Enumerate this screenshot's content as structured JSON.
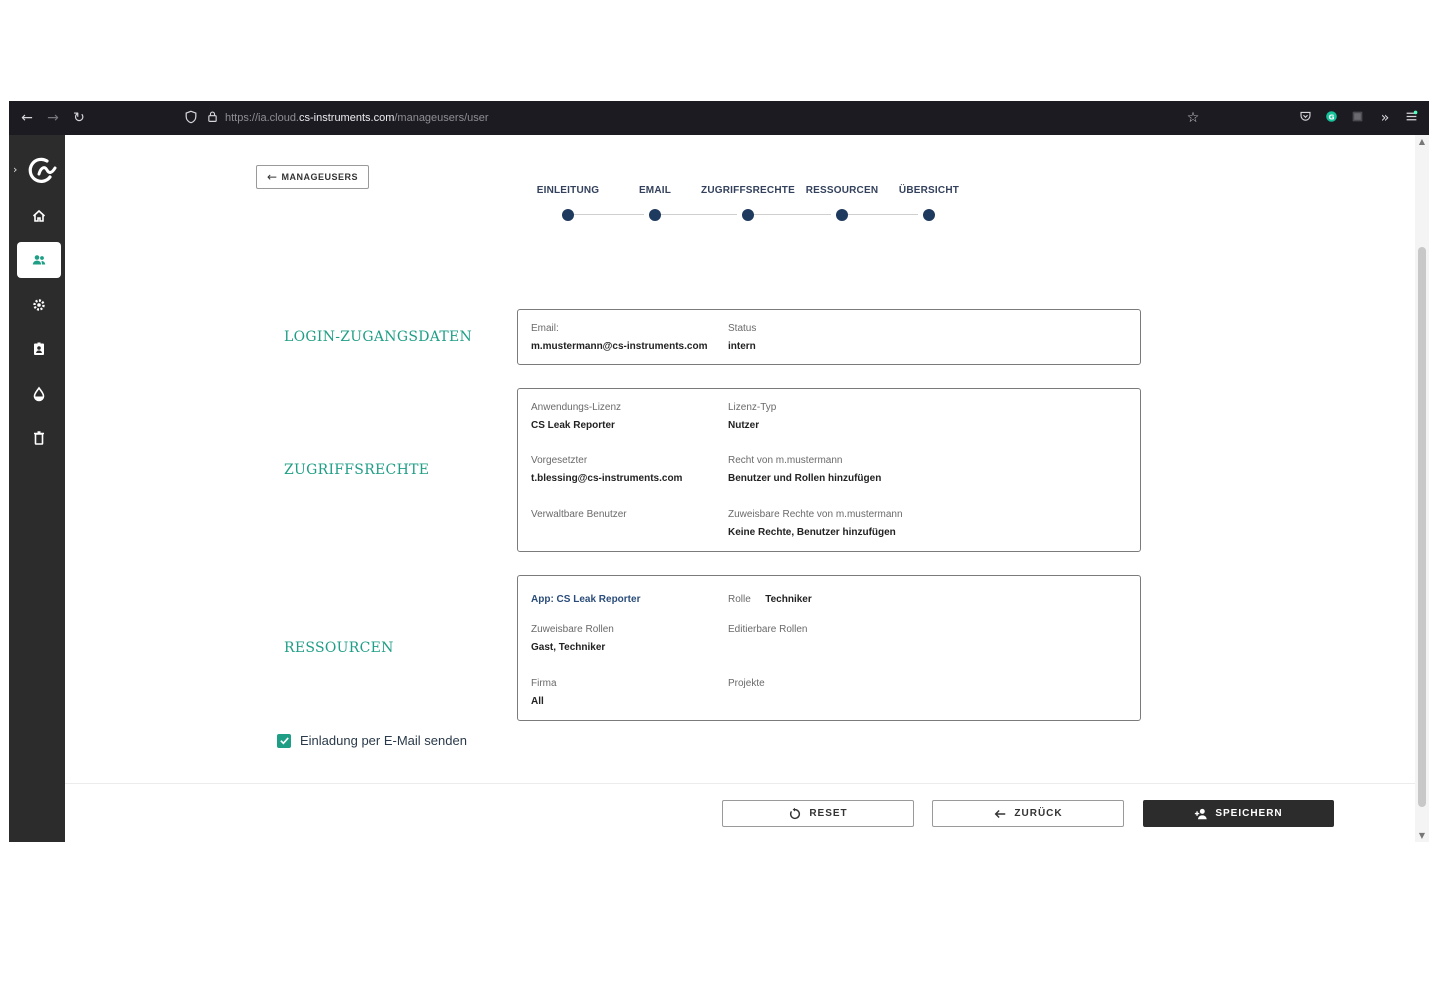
{
  "browser": {
    "url_prefix": "https://ia.cloud.",
    "url_host": "cs-instruments.com",
    "url_path": "/manageusers/user"
  },
  "page": {
    "back_label": "MANAGEUSERS"
  },
  "stepper": {
    "steps": [
      "EINLEITUNG",
      "EMAIL",
      "ZUGRIFFSRECHTE",
      "RESSOURCEN",
      "ÜBERSICHT"
    ]
  },
  "sections": {
    "login": {
      "title": "LOGIN-ZUGANGSDATEN",
      "email_label": "Email:",
      "email_value": "m.mustermann@cs-instruments.com",
      "status_label": "Status",
      "status_value": "intern"
    },
    "access": {
      "title": "ZUGRIFFSRECHTE",
      "license_label": "Anwendungs-Lizenz",
      "license_value": "CS Leak Reporter",
      "license_type_label": "Lizenz-Typ",
      "license_type_value": "Nutzer",
      "supervisor_label": "Vorgesetzter",
      "supervisor_value": "t.blessing@cs-instruments.com",
      "rights_label": "Recht von m.mustermann",
      "rights_value": "Benutzer und Rollen hinzufügen",
      "managed_label": "Verwaltbare Benutzer",
      "assignable_rights_label": "Zuweisbare Rechte von m.mustermann",
      "assignable_rights_value": "Keine Rechte, Benutzer hinzufügen"
    },
    "resources": {
      "title": "RESSOURCEN",
      "app_label": "App: CS Leak Reporter",
      "role_label": "Rolle",
      "role_value": "Techniker",
      "assignable_roles_label": "Zuweisbare Rollen",
      "assignable_roles_value": "Gast, Techniker",
      "editable_roles_label": "Editierbare Rollen",
      "company_label": "Firma",
      "company_value": "All",
      "projects_label": "Projekte"
    }
  },
  "invite": {
    "label": "Einladung per E-Mail senden",
    "checked": true
  },
  "footer": {
    "reset_label": "RESET",
    "back_label": "ZURÜCK",
    "save_label": "SPEICHERN"
  },
  "colors": {
    "accent": "#1f9e86",
    "sidebar": "#2c2c2c",
    "stepper_dot": "#1f3a5f",
    "primary_button": "#2c2c2c"
  }
}
